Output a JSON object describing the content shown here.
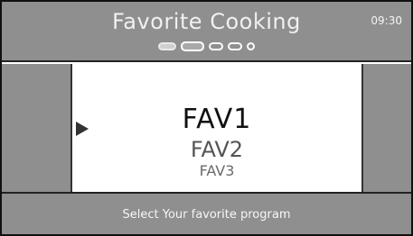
{
  "header": {
    "title": "Favorite Cooking",
    "clock": "09:30",
    "pager": {
      "pages": 5,
      "current_page": 2
    }
  },
  "program_list": {
    "items": [
      "FAV1",
      "FAV2",
      "FAV3"
    ],
    "selected": "FAV1"
  },
  "footer": {
    "hint": "Select Your favorite program"
  },
  "colors": {
    "bar_grey": "#a9a9a9",
    "panel_white": "#ffffff",
    "selected_text": "#111111"
  }
}
